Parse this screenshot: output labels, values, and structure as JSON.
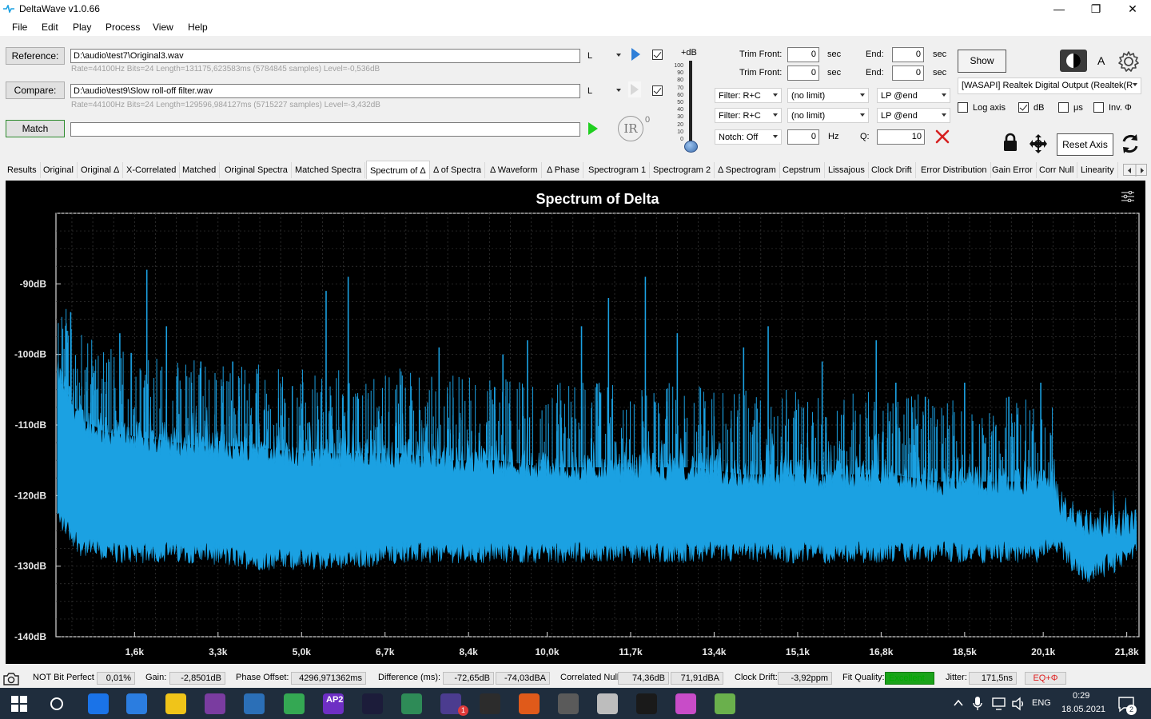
{
  "window": {
    "title": "DeltaWave v1.0.66",
    "controls": [
      "—",
      "❐",
      "✕"
    ]
  },
  "menu": [
    "File",
    "Edit",
    "Play",
    "Process",
    "View",
    "Help"
  ],
  "reference": {
    "button": "Reference:",
    "path": "D:\\audio\\test7\\Original3.wav",
    "info": "Rate=44100Hz Bits=24 Length=131175,623583ms (5784845 samples) Level=-0,536dB",
    "channel": "L"
  },
  "compare": {
    "button": "Compare:",
    "path": "D:\\audio\\test9\\Slow roll-off filter.wav",
    "info": "Rate=44100Hz Bits=24 Length=129596,984127ms (5715227 samples) Level=-3,432dB",
    "channel": "L"
  },
  "match": {
    "button": "Match",
    "ir": "IR",
    "ir_sup": "0"
  },
  "slider": {
    "title": "+dB",
    "ticks": [
      "100",
      "90",
      "80",
      "70",
      "60",
      "50",
      "40",
      "30",
      "20",
      "10",
      "0"
    ],
    "value": 0
  },
  "trim": {
    "front_label": "Trim Front:",
    "end_label": "End:",
    "unit": "sec",
    "ref_front": "0",
    "ref_end": "0",
    "cmp_front": "0",
    "cmp_end": "0"
  },
  "filters": {
    "filter1": "Filter: R+C",
    "limit1": "(no limit)",
    "lp1": "LP @end",
    "filter2": "Filter: R+C",
    "limit2": "(no limit)",
    "lp2": "LP @end",
    "notch": "Notch: Off",
    "notch_value": "0",
    "hz": "Hz",
    "q_label": "Q:",
    "q_value": "10"
  },
  "output": {
    "show": "Show",
    "a_label": "A",
    "device": "[WASAPI] Realtek Digital Output (Realtek(R",
    "log_axis": "Log axis",
    "db": "dB",
    "us": "μs",
    "inv": "Inv. Φ",
    "reset_axis": "Reset Axis"
  },
  "tabs": [
    "Results",
    "Original",
    "Original Δ",
    "X-Correlated",
    "Matched",
    "Original Spectra",
    "Matched Spectra",
    "Spectrum of Δ",
    "Δ of Spectra",
    "Δ Waveform",
    "Δ Phase",
    "Spectrogram 1",
    "Spectrogram 2",
    "Δ Spectrogram",
    "Cepstrum",
    "Lissajous",
    "Clock Drift",
    "Error Distribution",
    "Gain Error",
    "Corr Null",
    "Linearity"
  ],
  "selected_tab": "Spectrum of Δ",
  "chart_data": {
    "type": "line",
    "title": "Spectrum of Delta",
    "xlabel": "",
    "ylabel": "",
    "xlim": [
      0,
      22050
    ],
    "ylim": [
      -140,
      -80
    ],
    "x_ticks": [
      "1,6k",
      "3,3k",
      "5,0k",
      "6,7k",
      "8,4k",
      "10,0k",
      "11,7k",
      "13,4k",
      "15,1k",
      "16,8k",
      "18,5k",
      "20,1k",
      "21,8k"
    ],
    "x_tick_values": [
      1600,
      3300,
      5000,
      6700,
      8400,
      10000,
      11700,
      13400,
      15100,
      16800,
      18500,
      20100,
      21800
    ],
    "y_ticks": [
      "-90dB",
      "-100dB",
      "-110dB",
      "-120dB",
      "-130dB",
      "-140dB"
    ],
    "y_tick_values": [
      -90,
      -100,
      -110,
      -120,
      -130,
      -140
    ],
    "grid": true,
    "color": "#1ba1e2",
    "envelope": {
      "x": [
        50,
        500,
        1000,
        2000,
        3000,
        4000,
        5000,
        6000,
        7000,
        8000,
        9000,
        10000,
        11000,
        12000,
        13000,
        14000,
        15000,
        16000,
        17000,
        18000,
        19000,
        20000,
        20300,
        20500,
        21000,
        22000
      ],
      "top": [
        -103,
        -109,
        -111,
        -112,
        -113,
        -113,
        -114,
        -114,
        -114,
        -115,
        -115,
        -116,
        -116,
        -116,
        -116,
        -117,
        -117,
        -117,
        -117,
        -118,
        -118,
        -118,
        -119,
        -122,
        -124,
        -124
      ],
      "floor": [
        -123,
        -127,
        -128,
        -128,
        -128,
        -129,
        -129,
        -129,
        -128,
        -128,
        -128,
        -128,
        -128,
        -128,
        -128,
        -128,
        -128,
        -128,
        -128,
        -128,
        -128,
        -128,
        -126,
        -128,
        -131,
        -128
      ]
    },
    "peaks": [
      {
        "x": 300,
        "y": -94
      },
      {
        "x": 1300,
        "y": -97
      },
      {
        "x": 1850,
        "y": -88
      },
      {
        "x": 2250,
        "y": -96
      },
      {
        "x": 2950,
        "y": -101
      },
      {
        "x": 3600,
        "y": -101
      },
      {
        "x": 5500,
        "y": -91
      },
      {
        "x": 5950,
        "y": -89
      },
      {
        "x": 7800,
        "y": -99
      },
      {
        "x": 9100,
        "y": -100
      },
      {
        "x": 9600,
        "y": -98
      },
      {
        "x": 10700,
        "y": -96
      },
      {
        "x": 11250,
        "y": -92
      },
      {
        "x": 12000,
        "y": -89
      },
      {
        "x": 12650,
        "y": -97
      },
      {
        "x": 14000,
        "y": -99
      },
      {
        "x": 14500,
        "y": -96
      },
      {
        "x": 15600,
        "y": -101
      },
      {
        "x": 16700,
        "y": -98
      },
      {
        "x": 17100,
        "y": -104
      },
      {
        "x": 17700,
        "y": -106
      },
      {
        "x": 18500,
        "y": -104
      },
      {
        "x": 19400,
        "y": -106
      },
      {
        "x": 20050,
        "y": -104
      }
    ]
  },
  "status": {
    "bit_perfect": "NOT Bit Perfect",
    "bit_perfect_value": "0,01%",
    "gain_label": "Gain:",
    "gain": "-2,8501dB",
    "phase_label": "Phase Offset:",
    "phase": "4296,971362ms",
    "diff_label": "Difference (ms):",
    "diff1": "-72,65dB",
    "diff2": "-74,03dBA",
    "corr_label": "Correlated Null:",
    "corr1": "74,36dB",
    "corr2": "71,91dBA",
    "drift_label": "Clock Drift:",
    "drift": "-3,92ppm",
    "fit_label": "Fit Quality:",
    "fit": "Excellent",
    "jitter_label": "Jitter:",
    "jitter": "171,5ns",
    "eq": "EQ+Φ"
  },
  "taskbar": {
    "lang": "ENG",
    "time": "0:29",
    "date": "18.05.2021",
    "notif": "2",
    "badge": "1",
    "ap2": "AP2",
    "colors": [
      "#1a73e8",
      "#2b7de0",
      "#f0c419",
      "#7a3ca0",
      "#2b6fb7",
      "#34a853",
      "#6e2fc4",
      "#1c1c3a",
      "#2e8b57",
      "#4b3c8f",
      "#2c2c2c",
      "#e05a1a",
      "#5a5a5a",
      "#bdbdbd",
      "#1a1a1a",
      "#c84cc8",
      "#6ab04c"
    ]
  }
}
